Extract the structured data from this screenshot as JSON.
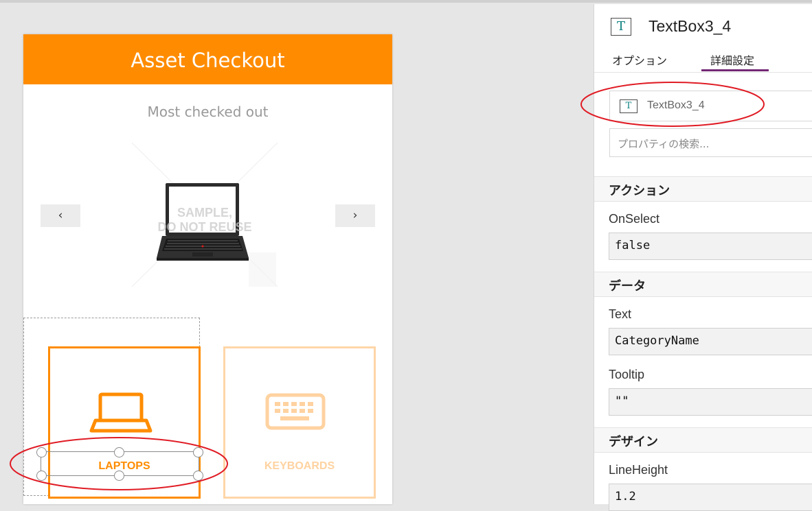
{
  "app": {
    "title": "Asset Checkout",
    "subtitle": "Most checked out",
    "prev_glyph": "‹",
    "next_glyph": "›",
    "watermark": "SAMPLE,\nDO NOT REUSE",
    "tiles": [
      {
        "label": "LAPTOPS",
        "icon": "laptop-icon"
      },
      {
        "label": "KEYBOARDS",
        "icon": "keyboard-icon"
      }
    ],
    "accent": "#ff8c00",
    "accent_light": "#ffd6a8"
  },
  "panel": {
    "control_type_glyph": "T",
    "title": "TextBox3_4",
    "tabs": [
      "オプション",
      "詳細設定"
    ],
    "active_tab": "詳細設定",
    "selected_control": "TextBox3_4",
    "search_placeholder": "プロパティの検索...",
    "sections": [
      {
        "heading": "アクション",
        "props": [
          {
            "label": "OnSelect",
            "value": "false"
          }
        ]
      },
      {
        "heading": "データ",
        "props": [
          {
            "label": "Text",
            "value": "CategoryName"
          },
          {
            "label": "Tooltip",
            "value": "\"\""
          }
        ]
      },
      {
        "heading": "デザイン",
        "props": [
          {
            "label": "LineHeight",
            "value": "1.2"
          }
        ]
      }
    ],
    "tab_accent": "#742774",
    "annotation_color": "#e01b24"
  }
}
